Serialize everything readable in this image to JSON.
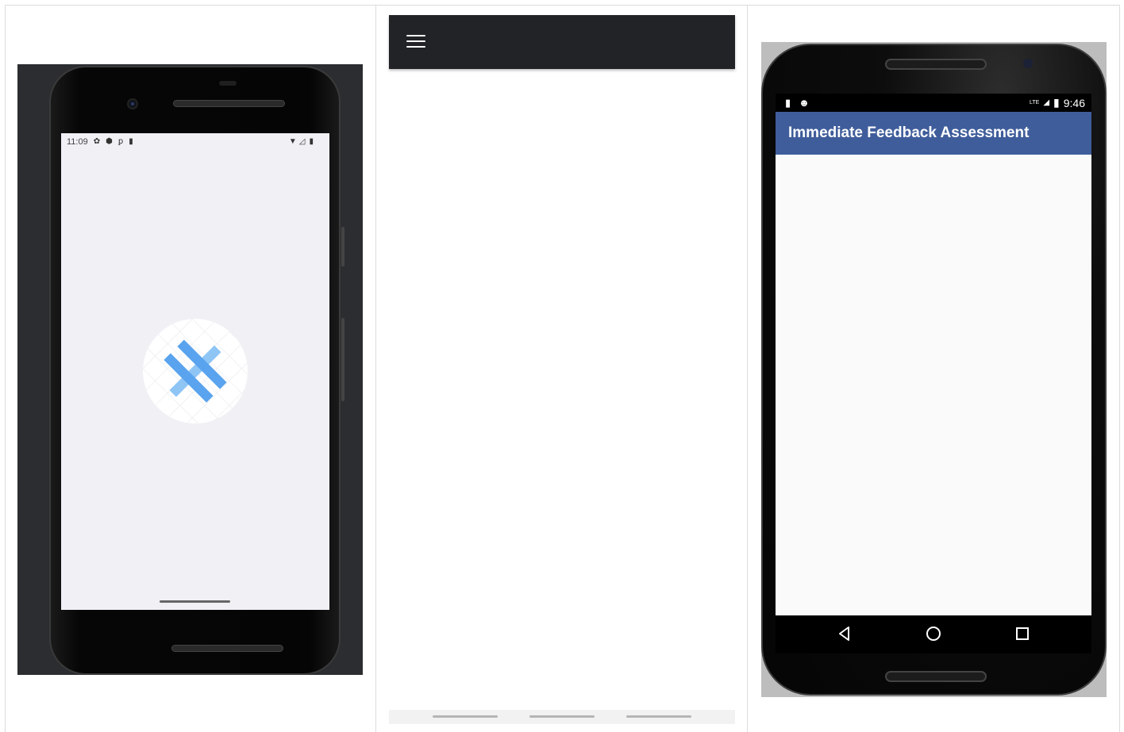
{
  "panel_left": {
    "status_bar": {
      "time": "11:09",
      "left_icons": [
        "gear-icon",
        "shield-icon",
        "usb-icon",
        "sd-card-icon"
      ],
      "right_icons": [
        "wifi-icon",
        "signal-icon",
        "battery-icon"
      ]
    },
    "splash_logo": "crossed-bars-logo"
  },
  "panel_middle": {
    "toolbar": {
      "menu_icon": "hamburger-menu-icon"
    },
    "footer": {
      "page_indicator_count": 3
    }
  },
  "panel_right": {
    "status_bar": {
      "left_icons": [
        "sd-card-icon",
        "android-icon"
      ],
      "network": "LTE",
      "time": "9:46"
    },
    "app_bar": {
      "title": "Immediate Feedback Assessment"
    },
    "nav_bar": {
      "buttons": [
        "back-icon",
        "home-icon",
        "recents-icon"
      ]
    },
    "colors": {
      "app_bar": "#3f5d9b",
      "content_bg": "#fafafa"
    }
  }
}
